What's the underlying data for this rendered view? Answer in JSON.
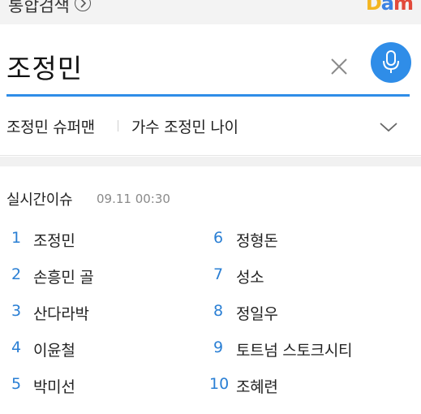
{
  "header": {
    "title": "통합검색",
    "logo": "Daum"
  },
  "search": {
    "query": "조정민"
  },
  "suggestions": [
    "조정민 슈퍼맨",
    "가수 조정민 나이"
  ],
  "realtime": {
    "title": "실시간이슈",
    "time": "09.11 00:30",
    "left": [
      {
        "rank": "1",
        "label": "조정민"
      },
      {
        "rank": "2",
        "label": "손흥민 골"
      },
      {
        "rank": "3",
        "label": "산다라박"
      },
      {
        "rank": "4",
        "label": "이윤철"
      },
      {
        "rank": "5",
        "label": "박미선"
      }
    ],
    "right": [
      {
        "rank": "6",
        "label": "정형돈"
      },
      {
        "rank": "7",
        "label": "성소"
      },
      {
        "rank": "8",
        "label": "정일우"
      },
      {
        "rank": "9",
        "label": "토트넘 스토크시티"
      },
      {
        "rank": "10",
        "label": "조혜련"
      }
    ]
  },
  "colors": {
    "accent": "#2f8de8",
    "rank_number": "#2a7fd4"
  }
}
